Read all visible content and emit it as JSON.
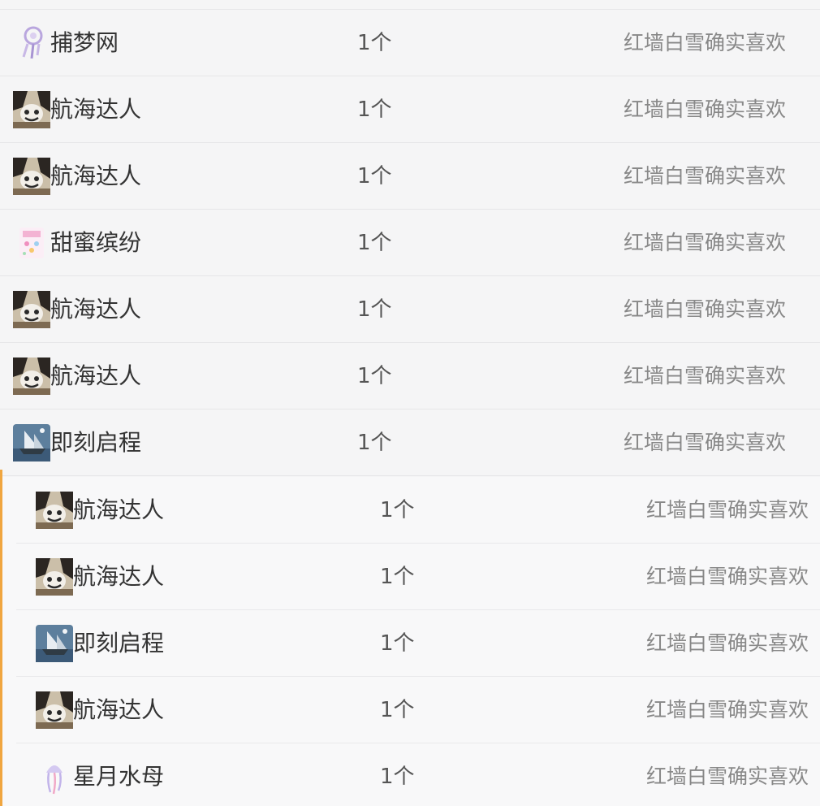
{
  "gift_list": {
    "rows": [
      {
        "icon": "dreamcatcher-icon",
        "name": "捕梦网",
        "count": "1个",
        "sender": "红墙白雪确实喜欢"
      },
      {
        "icon": "navigator-icon",
        "name": "航海达人",
        "count": "1个",
        "sender": "红墙白雪确实喜欢"
      },
      {
        "icon": "navigator-icon",
        "name": "航海达人",
        "count": "1个",
        "sender": "红墙白雪确实喜欢"
      },
      {
        "icon": "candy-confetti-icon",
        "name": "甜蜜缤纷",
        "count": "1个",
        "sender": "红墙白雪确实喜欢"
      },
      {
        "icon": "navigator-icon",
        "name": "航海达人",
        "count": "1个",
        "sender": "红墙白雪确实喜欢"
      },
      {
        "icon": "navigator-icon",
        "name": "航海达人",
        "count": "1个",
        "sender": "红墙白雪确实喜欢"
      },
      {
        "icon": "set-sail-ship-icon",
        "name": "即刻启程",
        "count": "1个",
        "sender": "红墙白雪确实喜欢"
      }
    ],
    "sub_rows": [
      {
        "icon": "navigator-icon",
        "name": "航海达人",
        "count": "1个",
        "sender": "红墙白雪确实喜欢"
      },
      {
        "icon": "navigator-icon",
        "name": "航海达人",
        "count": "1个",
        "sender": "红墙白雪确实喜欢"
      },
      {
        "icon": "set-sail-ship-icon",
        "name": "即刻启程",
        "count": "1个",
        "sender": "红墙白雪确实喜欢"
      },
      {
        "icon": "navigator-icon",
        "name": "航海达人",
        "count": "1个",
        "sender": "红墙白雪确实喜欢"
      },
      {
        "icon": "jellyfish-icon",
        "name": "星月水母",
        "count": "1个",
        "sender": "红墙白雪确实喜欢"
      }
    ],
    "accent_color": "#f0a640"
  }
}
